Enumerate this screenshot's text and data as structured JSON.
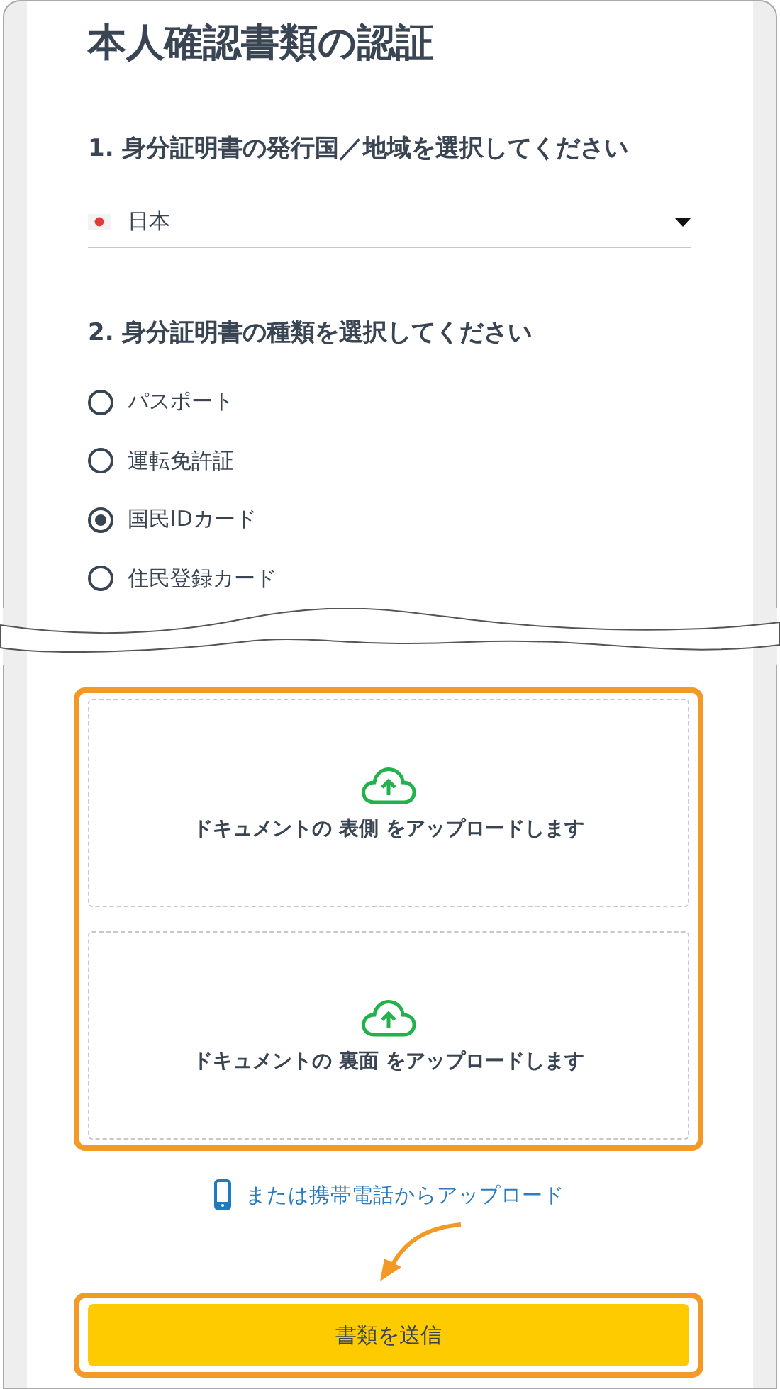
{
  "title": "本人確認書類の認証",
  "country": {
    "heading": "1. 身分証明書の発行国／地域を選択してください",
    "value": "日本"
  },
  "doc_type": {
    "heading": "2. 身分証明書の種類を選択してください",
    "options": [
      {
        "label": "パスポート",
        "selected": false
      },
      {
        "label": "運転免許証",
        "selected": false
      },
      {
        "label": "国民IDカード",
        "selected": true
      },
      {
        "label": "住民登録カード",
        "selected": false
      }
    ]
  },
  "uploads": [
    {
      "label": "ドキュメントの 表側 をアップロードします"
    },
    {
      "label": "ドキュメントの 裏面 をアップロードします"
    }
  ],
  "mobile_link": "または携帯電話からアップロード",
  "submit": "書類を送信"
}
